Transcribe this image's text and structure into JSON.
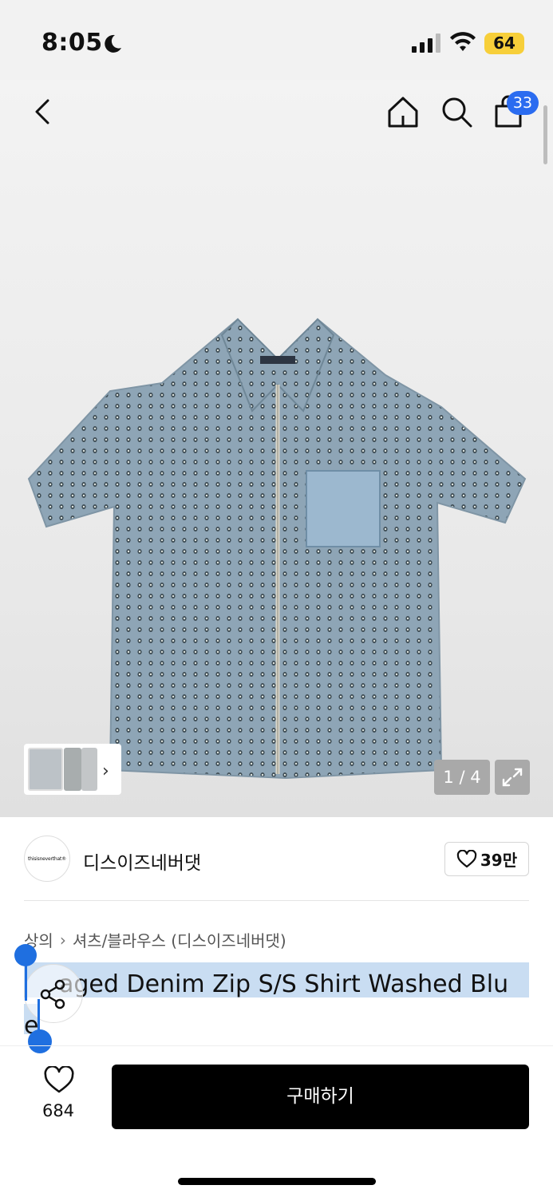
{
  "status_bar": {
    "time": "8:05",
    "battery": "64"
  },
  "nav": {
    "cart_count": "33"
  },
  "gallery": {
    "counter": "1 / 4"
  },
  "brand": {
    "logo_text": "thisisneverthat®",
    "name": "디스이즈네버댓",
    "likes": "39만"
  },
  "breadcrumb": {
    "items": [
      "상의",
      "셔츠/블라우스 (디스이즈네버댓)"
    ]
  },
  "product": {
    "title": "Damaged Denim Zip S/S Shirt Washed Blue",
    "title_visible": "aged Denim Zip S/S Shirt Washed Blu",
    "title_line2": "e"
  },
  "bottom_bar": {
    "like_count": "684",
    "buy_label": "구매하기"
  },
  "colors": {
    "accent": "#2b6cf0",
    "selection": "#1f6fe0",
    "highlight": "#c9ddf2",
    "battery": "#f7cf3a"
  }
}
